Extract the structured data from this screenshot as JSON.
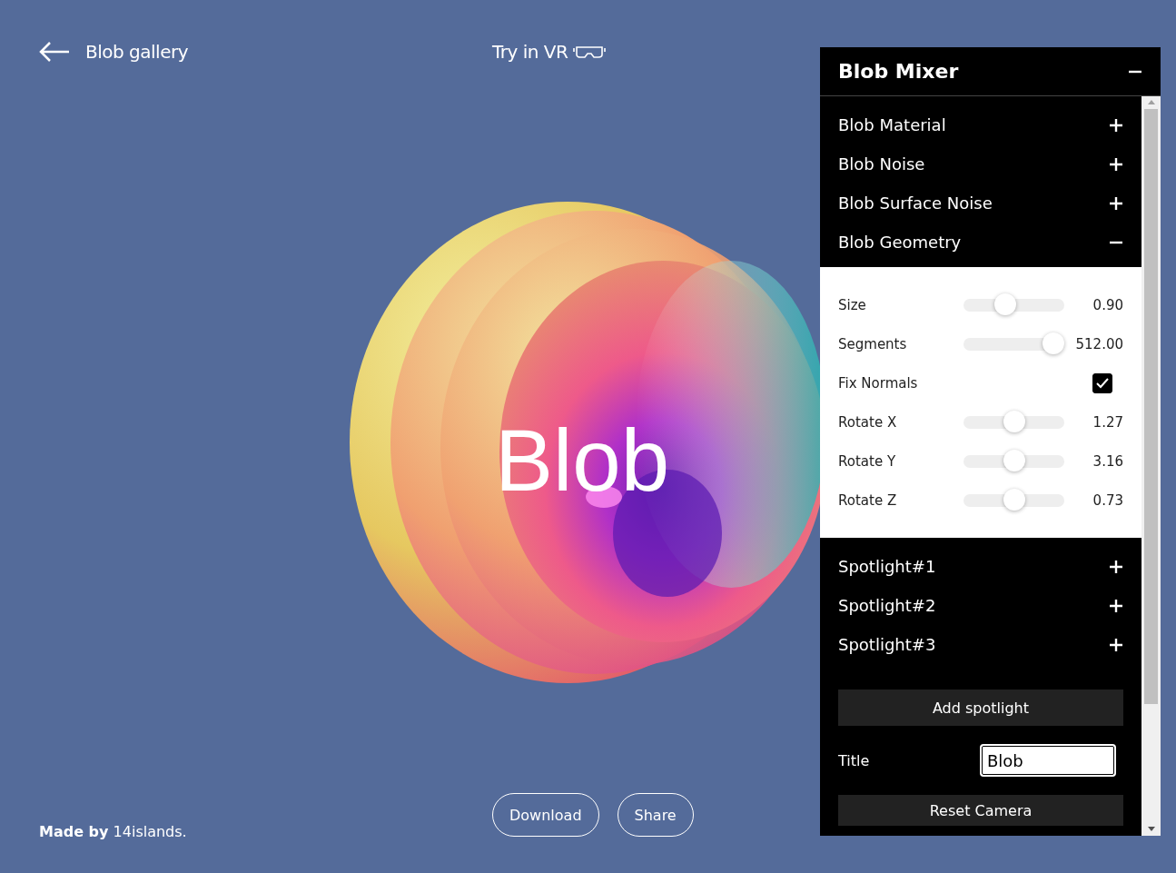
{
  "header": {
    "back_label": "Blob gallery",
    "vr_label": "Try in VR"
  },
  "canvas": {
    "kind": "picture",
    "title": "Blob"
  },
  "footer": {
    "credit": "**Made by** 14islands.",
    "buttons": [
      "Download",
      "Share"
    ]
  },
  "panel": {
    "title": "Blob Mixer",
    "expanded": true,
    "sections": [
      {
        "label": "Blob Material",
        "expanded": false
      },
      {
        "label": "Blob Noise",
        "expanded": false
      },
      {
        "label": "Blob Surface Noise",
        "expanded": false
      },
      {
        "label": "Blob Geometry",
        "expanded": true,
        "controls": [
          {
            "kind": "slider",
            "label": "Size",
            "level": 0.39,
            "reading": "0.90"
          },
          {
            "kind": "slider",
            "label": "Segments",
            "level": 1.0,
            "reading": "512.00"
          },
          {
            "kind": "checkbox",
            "label": "Fix Normals",
            "checked": true
          },
          {
            "kind": "slider",
            "label": "Rotate X",
            "level": 0.5,
            "reading": "1.27"
          },
          {
            "kind": "slider",
            "label": "Rotate Y",
            "level": 0.5,
            "reading": "3.16"
          },
          {
            "kind": "slider",
            "label": "Rotate Z",
            "level": 0.5,
            "reading": "0.73"
          }
        ]
      },
      {
        "label": "Spotlight#1",
        "expanded": false
      },
      {
        "label": "Spotlight#2",
        "expanded": false
      },
      {
        "label": "Spotlight#3",
        "expanded": false
      }
    ],
    "add_button": "Add spotlight",
    "title_field": {
      "label": "Title",
      "value": "Blob"
    },
    "reset_button": "Reset Camera"
  }
}
